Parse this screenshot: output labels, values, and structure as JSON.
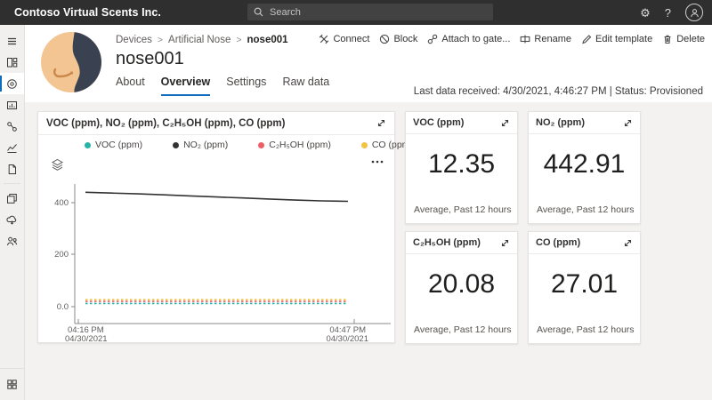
{
  "topbar": {
    "app_title": "Contoso Virtual Scents Inc.",
    "search_placeholder": "Search",
    "help_label": "?"
  },
  "sidebar": {
    "items": [
      "menu",
      "dashboard",
      "devices",
      "device-groups",
      "rules",
      "analytics",
      "jobs",
      "device-templates",
      "data-export",
      "organizations"
    ],
    "selected": "devices",
    "bottom_item": "app-switcher",
    "accent_color": "#0f6cbd"
  },
  "header": {
    "breadcrumb": [
      "Devices",
      "Artificial Nose",
      "nose001"
    ],
    "breadcrumb_separator": ">",
    "title": "nose001",
    "tabs": [
      {
        "label": "About",
        "active": false
      },
      {
        "label": "Overview",
        "active": true
      },
      {
        "label": "Settings",
        "active": false
      },
      {
        "label": "Raw data",
        "active": false
      }
    ],
    "toolbar": [
      {
        "label": "Connect",
        "icon": "connect-icon"
      },
      {
        "label": "Block",
        "icon": "block-icon"
      },
      {
        "label": "Attach to gate...",
        "icon": "attach-gateway-icon"
      },
      {
        "label": "Rename",
        "icon": "rename-icon"
      },
      {
        "label": "Edit template",
        "icon": "edit-template-icon"
      },
      {
        "label": "Delete",
        "icon": "delete-icon"
      }
    ],
    "status_line": "Last data received: 4/30/2021, 4:46:27 PM  |  Status: Provisioned"
  },
  "chart_card": {
    "title": "VOC (ppm), NO₂ (ppm), C₂H₅OH (ppm), CO (ppm)",
    "more_label": "•••"
  },
  "chart_data": {
    "type": "line",
    "title": "VOC (ppm), NO₂ (ppm), C₂H₅OH (ppm), CO (ppm)",
    "legend_position": "top",
    "grid": false,
    "ylim": [
      0,
      520
    ],
    "y_ticks": [
      "0.0",
      "200",
      "400"
    ],
    "x_start": {
      "time": "04:16 PM",
      "date": "04/30/2021"
    },
    "x_end": {
      "time": "04:47 PM",
      "date": "04/30/2021"
    },
    "series": [
      {
        "name": "VOC (ppm)",
        "color": "#27b4a8",
        "style": "dashed",
        "values": [
          12.35,
          12.35
        ]
      },
      {
        "name": "NO₂ (ppm)",
        "color": "#333333",
        "style": "solid",
        "values": [
          440,
          437,
          434,
          430,
          426,
          422,
          418,
          414,
          410,
          407,
          405
        ]
      },
      {
        "name": "C₂H₅OH (ppm)",
        "color": "#ec5f66",
        "style": "dashed",
        "values": [
          20.08,
          20.08
        ]
      },
      {
        "name": "CO (ppm)",
        "color": "#f4c242",
        "style": "dashed",
        "values": [
          27.01,
          27.01
        ]
      }
    ]
  },
  "tiles": [
    {
      "title": "VOC (ppm)",
      "value": "12.35",
      "caption": "Average, Past 12 hours"
    },
    {
      "title": "NO₂ (ppm)",
      "value": "442.91",
      "caption": "Average, Past 12 hours"
    },
    {
      "title": "C₂H₅OH (ppm)",
      "value": "20.08",
      "caption": "Average, Past 12 hours"
    },
    {
      "title": "CO (ppm)",
      "value": "27.01",
      "caption": "Average, Past 12 hours"
    }
  ]
}
